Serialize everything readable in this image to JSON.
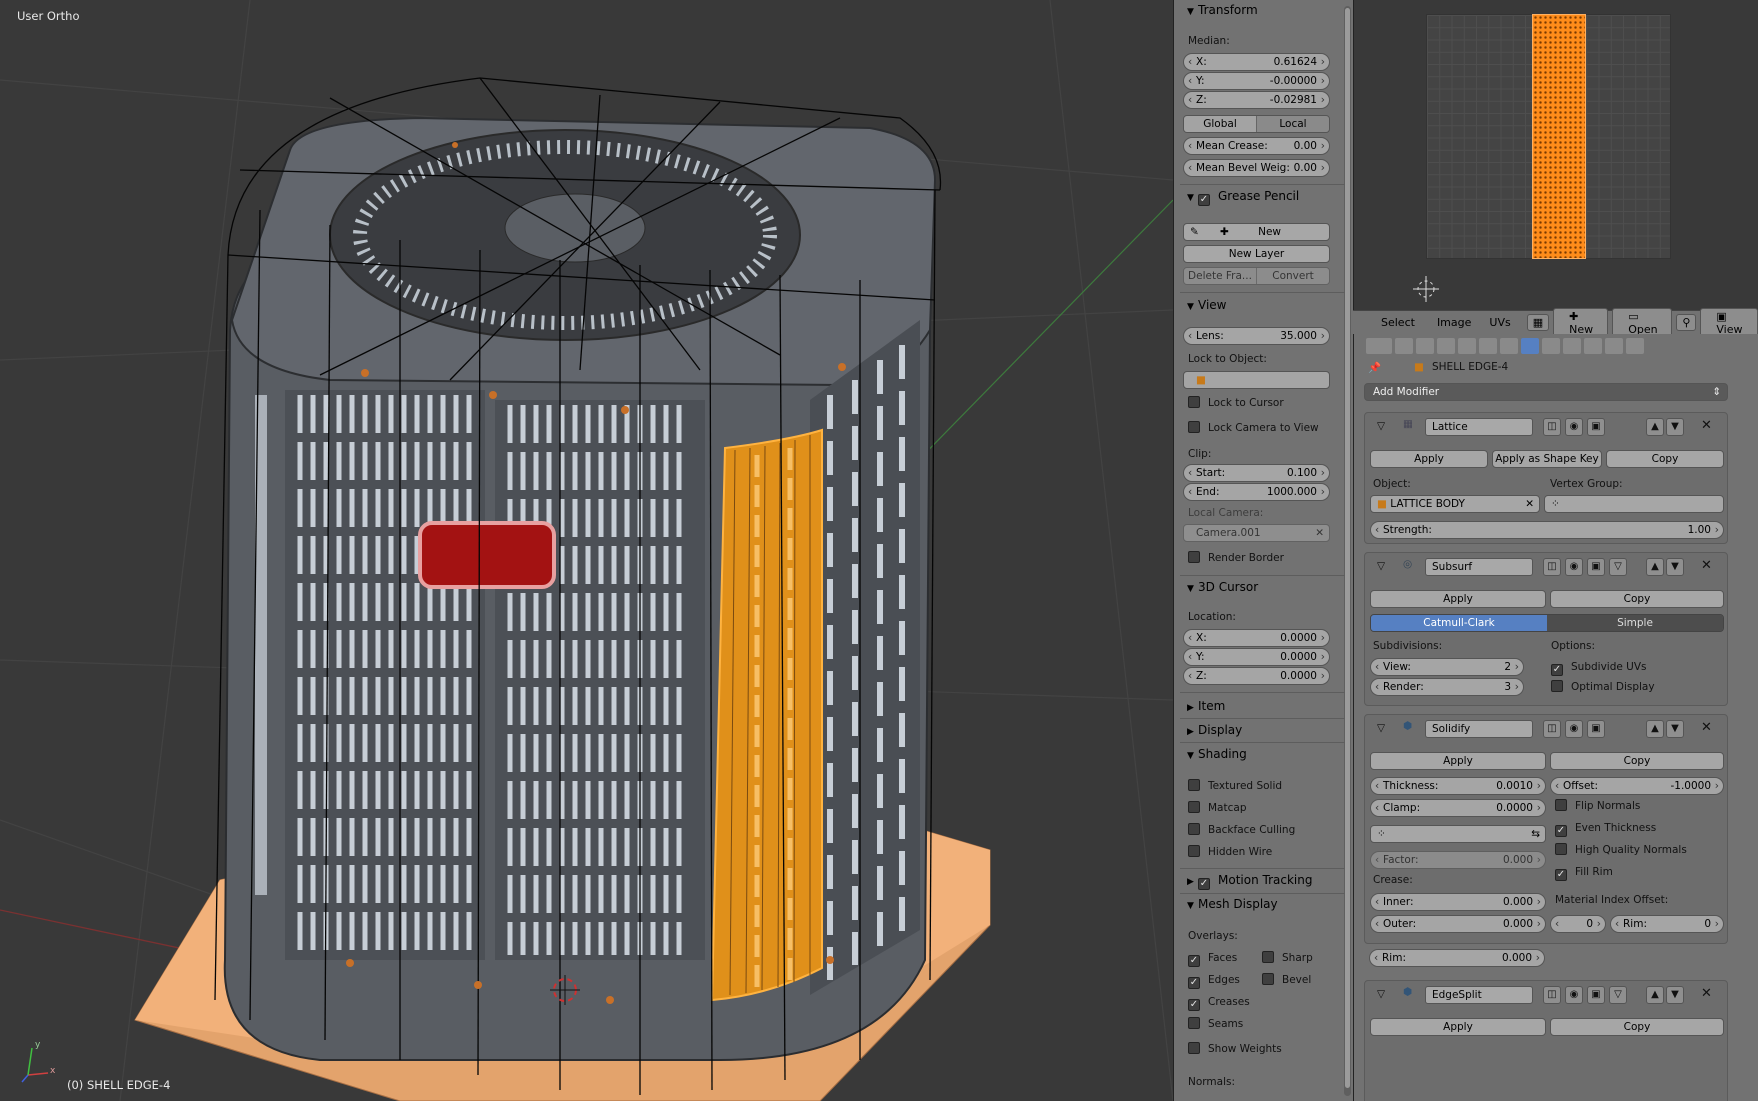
{
  "viewport": {
    "view_label": "User Ortho",
    "object_label": "(0) SHELL EDGE-4",
    "axis_x": "x",
    "axis_y": "y"
  },
  "npanel": {
    "transform": {
      "title": "Transform",
      "median_label": "Median:",
      "x": {
        "k": "X:",
        "v": "0.61624"
      },
      "y": {
        "k": "Y:",
        "v": "-0.00000"
      },
      "z": {
        "k": "Z:",
        "v": "-0.02981"
      },
      "global": "Global",
      "local": "Local",
      "mean_crease": {
        "k": "Mean Crease:",
        "v": "0.00"
      },
      "mean_bevel": {
        "k": "Mean Bevel Weig:",
        "v": "0.00"
      }
    },
    "grease_pencil": {
      "title": "Grease Pencil",
      "new": "New",
      "new_layer": "New Layer",
      "delete_frame": "Delete Fra...",
      "convert": "Convert"
    },
    "view": {
      "title": "View",
      "lens": {
        "k": "Lens:",
        "v": "35.000"
      },
      "lock_to_object": "Lock to Object:",
      "lock_to_cursor": "Lock to Cursor",
      "lock_camera": "Lock Camera to View",
      "clip": "Clip:",
      "start": {
        "k": "Start:",
        "v": "0.100"
      },
      "end": {
        "k": "End:",
        "v": "1000.000"
      },
      "local_camera": "Local Camera:",
      "camera_value": "Camera.001",
      "render_border": "Render Border"
    },
    "cursor": {
      "title": "3D Cursor",
      "location": "Location:",
      "x": {
        "k": "X:",
        "v": "0.0000"
      },
      "y": {
        "k": "Y:",
        "v": "0.0000"
      },
      "z": {
        "k": "Z:",
        "v": "0.0000"
      }
    },
    "item": "Item",
    "display": "Display",
    "shading": {
      "title": "Shading",
      "textured_solid": "Textured Solid",
      "matcap": "Matcap",
      "backface": "Backface Culling",
      "hidden_wire": "Hidden Wire"
    },
    "motion_tracking": "Motion Tracking",
    "mesh_display": {
      "title": "Mesh Display",
      "overlays": "Overlays:",
      "faces": "Faces",
      "sharp": "Sharp",
      "edges": "Edges",
      "bevel": "Bevel",
      "creases": "Creases",
      "seams": "Seams",
      "show_weights": "Show Weights",
      "normals": "Normals:"
    }
  },
  "uv_header": {
    "select": "Select",
    "image": "Image",
    "uvs": "UVs",
    "new": "New",
    "open": "Open",
    "view": "View"
  },
  "properties": {
    "object_name": "SHELL EDGE-4",
    "add_modifier": "Add Modifier",
    "lattice": {
      "name": "Lattice",
      "apply": "Apply",
      "apply_shape": "Apply as Shape Key",
      "copy": "Copy",
      "object_label": "Object:",
      "object_value": "LATTICE BODY",
      "vgroup_label": "Vertex Group:",
      "strength": {
        "k": "Strength:",
        "v": "1.00"
      }
    },
    "subsurf": {
      "name": "Subsurf",
      "apply": "Apply",
      "copy": "Copy",
      "catmull": "Catmull-Clark",
      "simple": "Simple",
      "subdivisions": "Subdivisions:",
      "options": "Options:",
      "view": {
        "k": "View:",
        "v": "2"
      },
      "render": {
        "k": "Render:",
        "v": "3"
      },
      "subdivide_uvs": "Subdivide UVs",
      "optimal": "Optimal Display"
    },
    "solidify": {
      "name": "Solidify",
      "apply": "Apply",
      "copy": "Copy",
      "thickness": {
        "k": "Thickness:",
        "v": "0.0010"
      },
      "offset": {
        "k": "Offset:",
        "v": "-1.0000"
      },
      "clamp": {
        "k": "Clamp:",
        "v": "0.0000"
      },
      "flip_normals": "Flip Normals",
      "even_thickness": "Even Thickness",
      "hq_normals": "High Quality Normals",
      "fill_rim": "Fill Rim",
      "factor": {
        "k": "Factor:",
        "v": "0.000"
      },
      "crease": "Crease:",
      "inner": {
        "k": "Inner:",
        "v": "0.000"
      },
      "outer": {
        "k": "Outer:",
        "v": "0.000"
      },
      "rim": {
        "k": "Rim:",
        "v": "0.000"
      },
      "mat_offset": "Material Index Offset:",
      "mat_val": "0",
      "mat_rim": {
        "k": "Rim:",
        "v": "0"
      }
    },
    "edgesplit": {
      "name": "EdgeSplit",
      "apply": "Apply",
      "copy": "Copy"
    }
  }
}
